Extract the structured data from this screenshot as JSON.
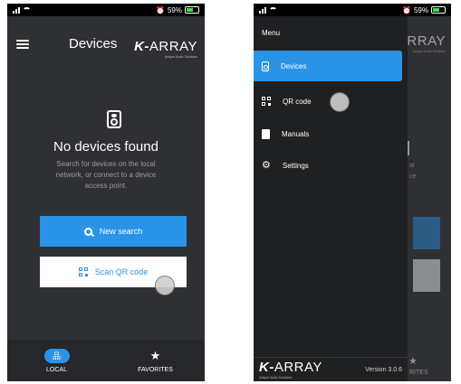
{
  "status": {
    "battery": "59%",
    "battery_level": 0.59
  },
  "header": {
    "title": "Devices"
  },
  "brand": {
    "logo_main": "ARRAY",
    "logo_k": "K-",
    "tagline": "Unique Audio Solutions"
  },
  "empty_state": {
    "title": "No devices found",
    "description": "Search for devices on the local network, or connect to a device access point."
  },
  "buttons": {
    "new_search": "New search",
    "scan_qr": "Scan QR code"
  },
  "bottom_nav": [
    {
      "label": "LOCAL",
      "icon": "network-icon",
      "active": true
    },
    {
      "label": "FAVORITES",
      "icon": "star-icon",
      "active": false
    }
  ],
  "drawer": {
    "title": "Menu",
    "items": [
      {
        "label": "Devices",
        "icon": "speaker-icon",
        "active": true
      },
      {
        "label": "QR code",
        "icon": "qr-code-icon",
        "active": false
      },
      {
        "label": "Manuals",
        "icon": "book-icon",
        "active": false
      },
      {
        "label": "Settings",
        "icon": "gear-icon",
        "active": false
      }
    ],
    "version": "Version 3.0.6"
  },
  "peek": {
    "favorites_partial": "RITES",
    "text1": "al",
    "text2": "ce"
  },
  "colors": {
    "accent": "#2a93e6",
    "background": "#2f3033",
    "drawer": "#1f2022",
    "battery": "#48d85a"
  }
}
